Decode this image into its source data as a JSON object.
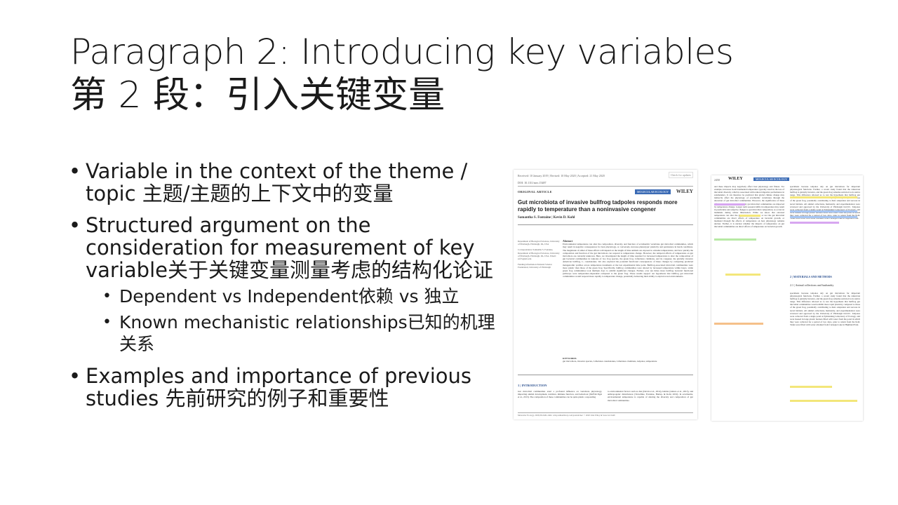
{
  "slide": {
    "title_en": "Paragraph 2: Introducing key variables",
    "title_zh": "第 2 段：引入关键变量",
    "bullets": [
      {
        "text": "Variable in the context of the theme / topic  主题/主题的上下文中的变量"
      },
      {
        "text": "Structured argument on the consideration for measurement of key variable关于关键变量测量考虑的结构化论证",
        "sub": [
          {
            "text": "Dependent vs Independent依赖 vs 独立"
          },
          {
            "text": "Known mechanistic relationships已知的机理关系"
          }
        ]
      },
      {
        "text": "Examples and importance of previous studies  先前研究的例子和重要性"
      }
    ]
  },
  "paper": {
    "dates": "Received: 10 January 2019   |   Revised: 10 May 2020   |   Accepted: 21 May 2020",
    "doi": "DOI: 10.1111/mec.15487",
    "check": "Check for updates",
    "type": "ORIGINAL ARTICLE",
    "journal": "MOLECULAR ECOLOGY",
    "publisher": "WILEY",
    "title": "Gut microbiota of invasive bullfrog tadpoles responds more rapidly to temperature than a noninvasive congener",
    "authors": "Samantha S. Fontaine  |  Kevin D. Kohl",
    "affiliation": "Department of Biological Sciences, University of Pittsburgh, Pittsburgh, PA, USA",
    "correspondence": "Correspondence Samantha S. Fontaine, Department of Biological Sciences, University of Pittsburgh, Pittsburgh, PA, USA. Email: ssf15@pitt.edu",
    "funding": "Funding information National Science Foundation; University of Pittsburgh",
    "abstract_heading": "Abstract",
    "abstract": "Environmental temperature can alter the composition, diversity, and function of ectothermic vertebrate gut microbial communities, which may result in negative consequences for host physiology, or conversely, increase phenotypic plasticity and persistence in harsh conditions. The magnitude of either of these effects will depend on the length of time animals are exposed to extreme temperatures, and how quickly the composition and function of the gut microbiota can respond to temperature change. However, the temporal effects of temperature on gut microbiota are currently unknown. Here, we investigated the length of time required for increased temperature to alter the composition of gut bacterial communities in tadpoles of two frog species, the green frog, Lithobates clamitans, and its congener, the globally invasive American bullfrog, L. catesbeianus. We also explored the potential functional consequences of these changes by comparing predicted metagenomic profiles across temperature treatments at the last experimental time point. Bullfrog-associated microbial communities were more plastic than those of the green frog. Specifically, bullfrog communities were altered by increased temperature within hours, while green frog communities took multiple days to exhibit significant changes. Further, over ten times more bullfrog bacterial functional pathways were temperature-dependent compared to the green frog. These results support our hypothesis that bullfrog gut microbial communities would respond more rapidly to temperature change, potentially bolstering their ability to exploit novel environments.",
    "keywords_heading": "KEYWORDS",
    "keywords": "gut microbiota, invasive species, Lithobates catesbeianus, Lithobates clamitans, tadpoles, temperature",
    "intro_heading": "1  |  INTRODUCTION",
    "intro_col1": "Gut microbial communities exert a profound influence on vertebrate physiology, impacting animal development, nutrition, immune function, and behaviour (McFall-Ngai et al., 2013). The composition of these communities can be quite plastic, responding",
    "intro_col2": "to environmental factors such as diet (David et al., 2014), habitat (Amato et al., 2013), and anthropogenic disturbances (Trevelline, Fontaine, Hartup, & Kohl, 2019). In ectotherms, environmental temperature is capable of altering the diversity and composition of gut microbial communities.",
    "footer": "Molecular Ecology. 2020;29:2449–2462.      wileyonlinelibrary.com/journal/mec      © 2020 John Wiley & Sons Ltd     2449",
    "page2_header": "2450",
    "page2_section": "2  |  MATERIALS AND METHODS",
    "page2_subsection": "2.1  |  Animal collections and husbandry",
    "page2_col1": "and these impacts may negatively affect host physiology and fitness. For example, increases in environmental temperature typically result in the loss of microbial diversity, which is associated with reduced digestive performance in salamanders. It can therefore be predicted that global climate change may indirectly affect the physiology of ectothermic vertebrates through the alteration of gut microbial communities. However, the significance of these effects may depend on how quickly gut microbial communities are impacted by temperature change. Longer term seasonal shifts in temperature may result in predictable and adaptive changes to gut microbial composition, as occurs in mammals during winter hibernation. While we know that elevated temperature can alter the gut microbiota, whether or not the gut microbial communities are direct effects of temperature on bacterial growth, or mediated through the effects of temperature on host physiology remains unclear. Further, it is unclear whether the impacts of temperature on gut microbial communities are direct effects of temperature on bacterial growth.",
    "page2_col2": "specimens because tadpoles rely on gut microbiota for important physiological functions. Further, a recent study found that the American bullfrog is globally invasive, and the green frog remains restricted to its native range. This difference allowed us to test the hypothesis that bullfrog gut microbial communities would exhibit more rapid plasticity compared to those of the green frog, potentially contributing to their adaptation and success in novel habitats. All animal collections, husbandry, and experimentation were reviewed and approved by the University of Pittsburgh IACUC. Tadpoles were collected from a single pond at Pymatuning Laboratory of Ecology, and were housed in large plastic buckets filled with water from the pond in which they were collected for a period of two days, prior to return from the field. Tanks were filled with water obtained from Carnegie Lake in Highland Park."
  }
}
